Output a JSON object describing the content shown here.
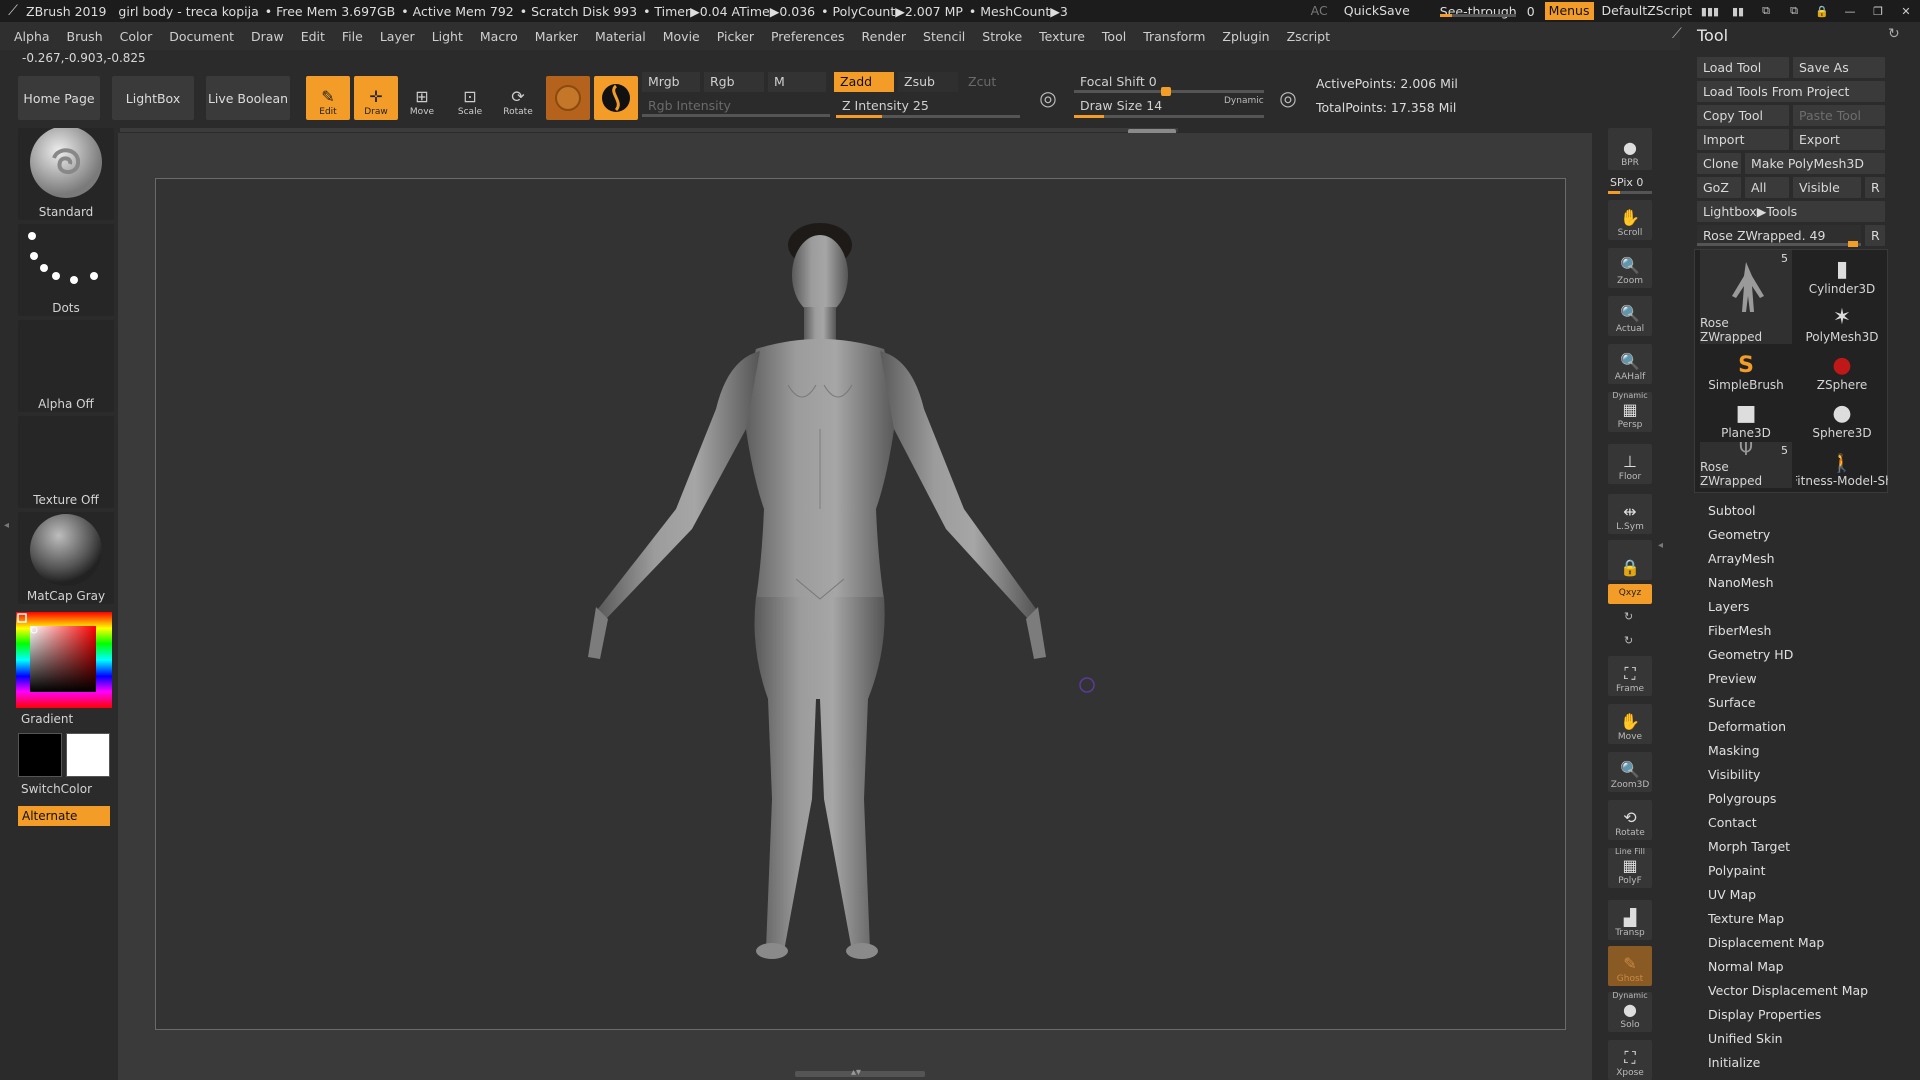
{
  "titlebar": {
    "app_title": "ZBrush 2019",
    "document": "girl body - treca kopija",
    "free_mem": "• Free Mem 3.697GB",
    "active_mem": "• Active Mem 792",
    "scratch_disk": "• Scratch Disk 993",
    "timer": "• Timer▶0.04 ATime▶0.036",
    "polycount": "• PolyCount▶2.007 MP",
    "meshcount": "• MeshCount▶3",
    "ac": "AC",
    "quicksave": "QuickSave",
    "see_through": "See-through",
    "see_through_value": "0",
    "see_through_level": 0.0,
    "menus": "Menus",
    "default_zscript": "DefaultZScript"
  },
  "menubar": [
    "Alpha",
    "Brush",
    "Color",
    "Document",
    "Draw",
    "Edit",
    "File",
    "Layer",
    "Light",
    "Macro",
    "Marker",
    "Material",
    "Movie",
    "Picker",
    "Preferences",
    "Render",
    "Stencil",
    "Stroke",
    "Texture",
    "Tool",
    "Transform",
    "Zplugin",
    "Zscript"
  ],
  "coords": "-0.267,-0.903,-0.825",
  "shelf": {
    "home_page": "Home Page",
    "lightbox": "LightBox",
    "live_boolean": "Live Boolean",
    "edit": "Edit",
    "draw": "Draw",
    "move": "Move",
    "scale": "Scale",
    "rotate": "Rotate",
    "mrgb": "Mrgb",
    "rgb": "Rgb",
    "m": "M",
    "rgb_intensity": "Rgb Intensity",
    "zadd": "Zadd",
    "zsub": "Zsub",
    "zcut": "Zcut",
    "z_intensity": "Z Intensity 25",
    "z_intensity_level": 0.25,
    "focal_shift": "Focal Shift 0",
    "draw_size": "Draw Size 14",
    "dynamic": "Dynamic",
    "active_points": "ActivePoints: 2.006 Mil",
    "total_points": "TotalPoints: 17.358 Mil"
  },
  "left_panel": {
    "brush": "Standard",
    "stroke": "Dots",
    "alpha": "Alpha Off",
    "texture": "Texture Off",
    "material": "MatCap Gray",
    "gradient": "Gradient",
    "switch_color": "SwitchColor",
    "alternate": "Alternate"
  },
  "right_shelf": {
    "bpr": "BPR",
    "spix": "SPix 0",
    "scroll": "Scroll",
    "zoom": "Zoom",
    "actual": "Actual",
    "aahalf": "AAHalf",
    "persp_top": "Dynamic",
    "persp": "Persp",
    "floor": "Floor",
    "lsym": "L.Sym",
    "xyz": "Qxyz",
    "frame": "Frame",
    "move": "Move",
    "zoom3d": "Zoom3D",
    "rotate": "Rotate",
    "polyf_top": "Line Fill",
    "polyf": "PolyF",
    "transp": "Transp",
    "ghost": "Ghost",
    "solo_top": "Dynamic",
    "solo": "Solo",
    "xpose": "Xpose"
  },
  "tool_panel": {
    "title": "Tool",
    "load_tool": "Load Tool",
    "save_as": "Save As",
    "load_from_project": "Load Tools From Project",
    "copy_tool": "Copy Tool",
    "paste_tool": "Paste Tool",
    "import": "Import",
    "export": "Export",
    "clone": "Clone",
    "make_polymesh": "Make PolyMesh3D",
    "goz": "GoZ",
    "all": "All",
    "visible": "Visible",
    "r": "R",
    "lightbox_tools": "Lightbox▶Tools",
    "current_tool": "Rose ZWrapped. 49",
    "thumbs": [
      {
        "label": "Rose ZWrapped",
        "badge": "5"
      },
      {
        "label": "Cylinder3D",
        "badge": ""
      },
      {
        "label": "PolyMesh3D",
        "badge": ""
      },
      {
        "label": "SimpleBrush",
        "badge": ""
      },
      {
        "label": "ZSphere",
        "badge": ""
      },
      {
        "label": "Plane3D",
        "badge": ""
      },
      {
        "label": "Sphere3D",
        "badge": ""
      },
      {
        "label": "Rose ZWrapped",
        "badge": "5"
      },
      {
        "label": "Fitness-Model-Sh",
        "badge": ""
      }
    ],
    "subpalettes": [
      "Subtool",
      "Geometry",
      "ArrayMesh",
      "NanoMesh",
      "Layers",
      "FiberMesh",
      "Geometry HD",
      "Preview",
      "Surface",
      "Deformation",
      "Masking",
      "Visibility",
      "Polygroups",
      "Contact",
      "Morph Target",
      "Polypaint",
      "UV Map",
      "Texture Map",
      "Displacement Map",
      "Normal Map",
      "Vector Displacement Map",
      "Display Properties",
      "Unified Skin",
      "Initialize"
    ]
  }
}
